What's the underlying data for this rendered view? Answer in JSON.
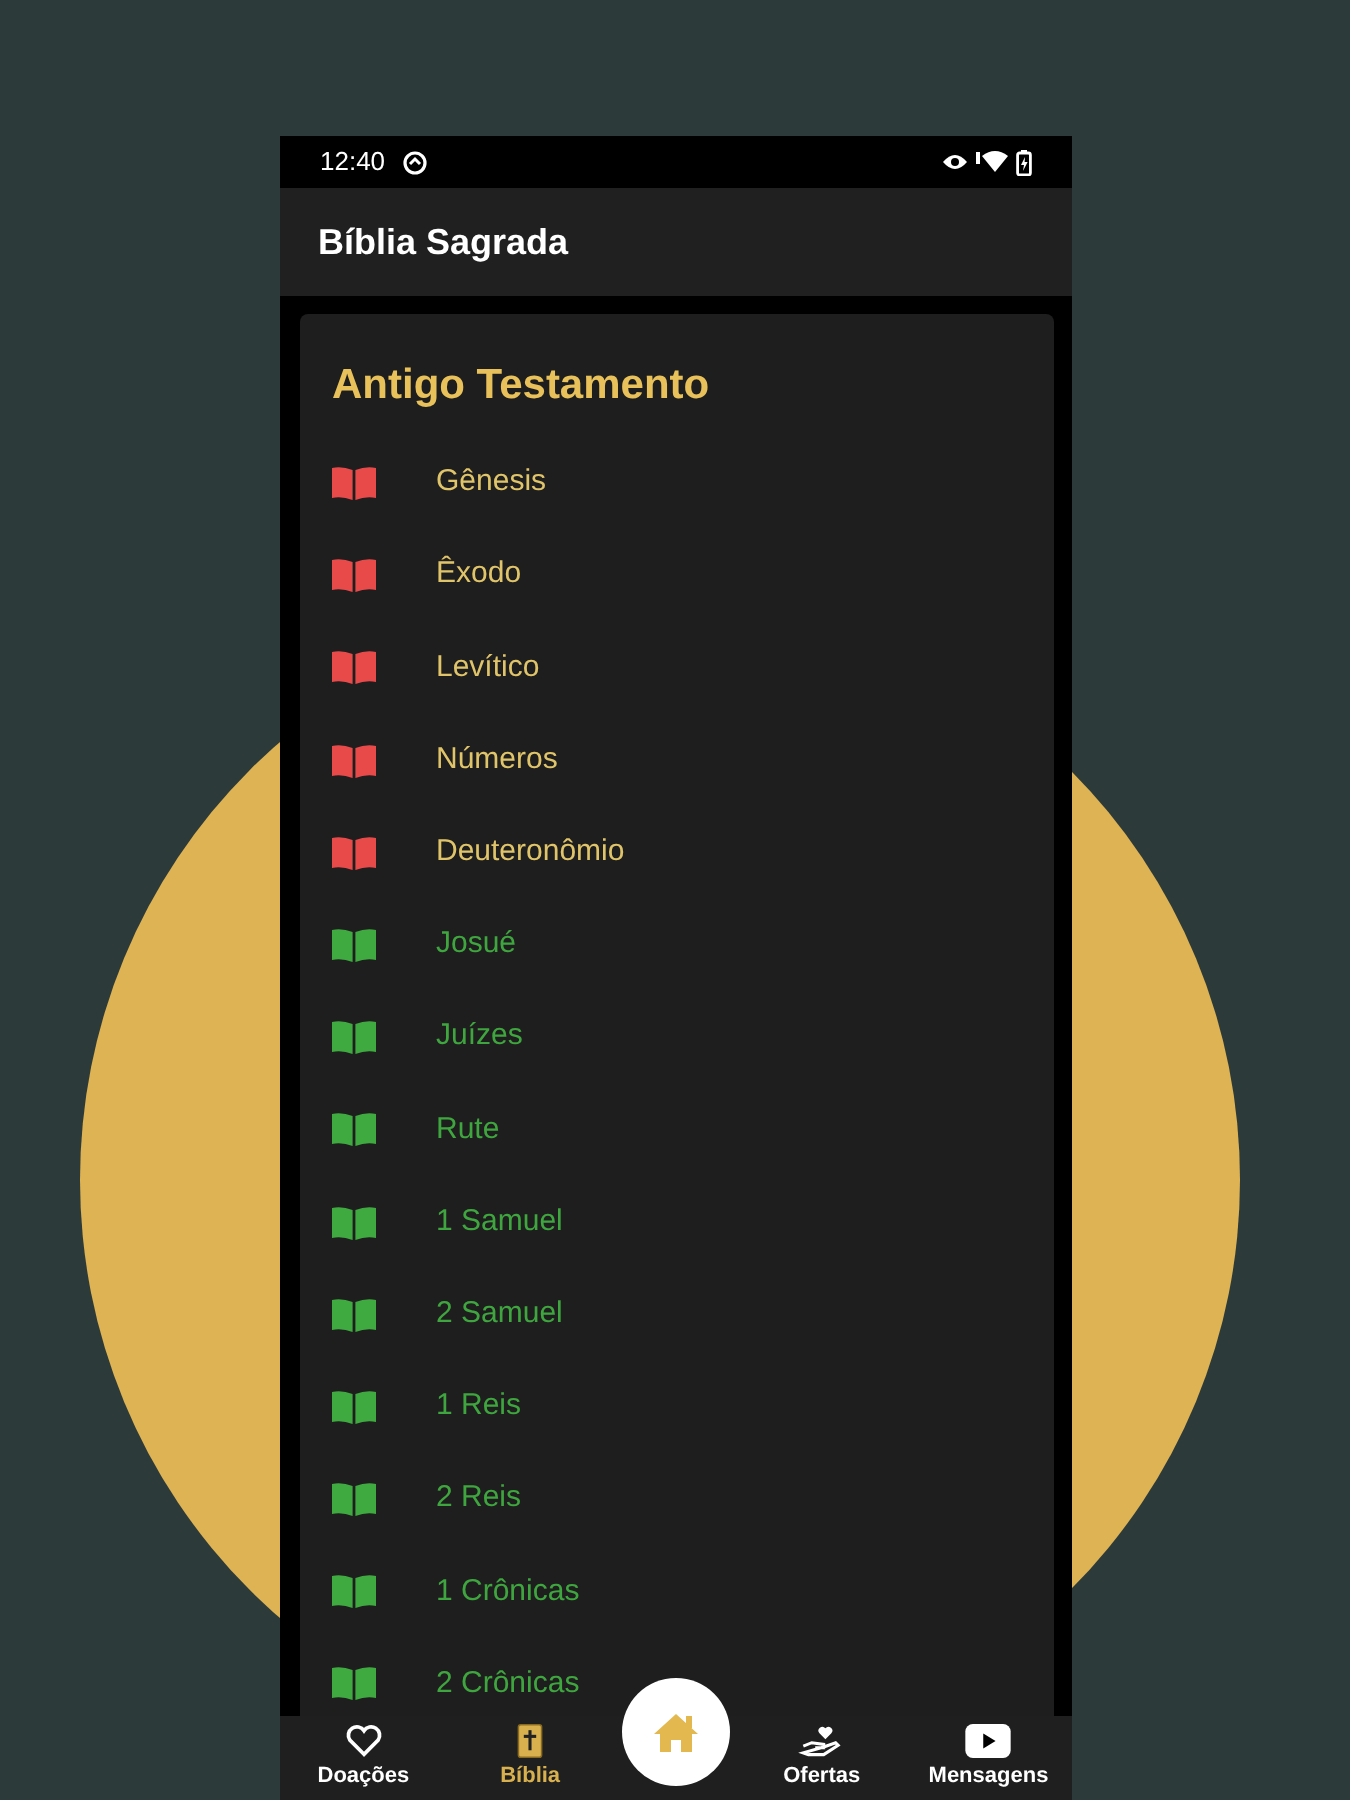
{
  "status_bar": {
    "time": "12:40"
  },
  "app_bar": {
    "title": "Bíblia Sagrada"
  },
  "section": {
    "title": "Antigo Testamento"
  },
  "books": [
    {
      "name": "Gênesis",
      "kind": "pentateuch"
    },
    {
      "name": "Êxodo",
      "kind": "pentateuch"
    },
    {
      "name": "Levítico",
      "kind": "pentateuch"
    },
    {
      "name": "Números",
      "kind": "pentateuch"
    },
    {
      "name": "Deuteronômio",
      "kind": "pentateuch"
    },
    {
      "name": "Josué",
      "kind": "history"
    },
    {
      "name": "Juízes",
      "kind": "history"
    },
    {
      "name": "Rute",
      "kind": "history"
    },
    {
      "name": "1 Samuel",
      "kind": "history"
    },
    {
      "name": "2 Samuel",
      "kind": "history"
    },
    {
      "name": "1 Reis",
      "kind": "history"
    },
    {
      "name": "2 Reis",
      "kind": "history"
    },
    {
      "name": "1 Crônicas",
      "kind": "history"
    },
    {
      "name": "2 Crônicas",
      "kind": "history"
    }
  ],
  "bottom_nav": [
    {
      "label": "Doações",
      "kind": "heart",
      "selected": false
    },
    {
      "label": "Bíblia",
      "kind": "bible",
      "selected": true
    },
    {
      "kind": "home",
      "selected": false
    },
    {
      "label": "Ofertas",
      "kind": "offer",
      "selected": false
    },
    {
      "label": "Mensagens",
      "kind": "video",
      "selected": false
    }
  ]
}
